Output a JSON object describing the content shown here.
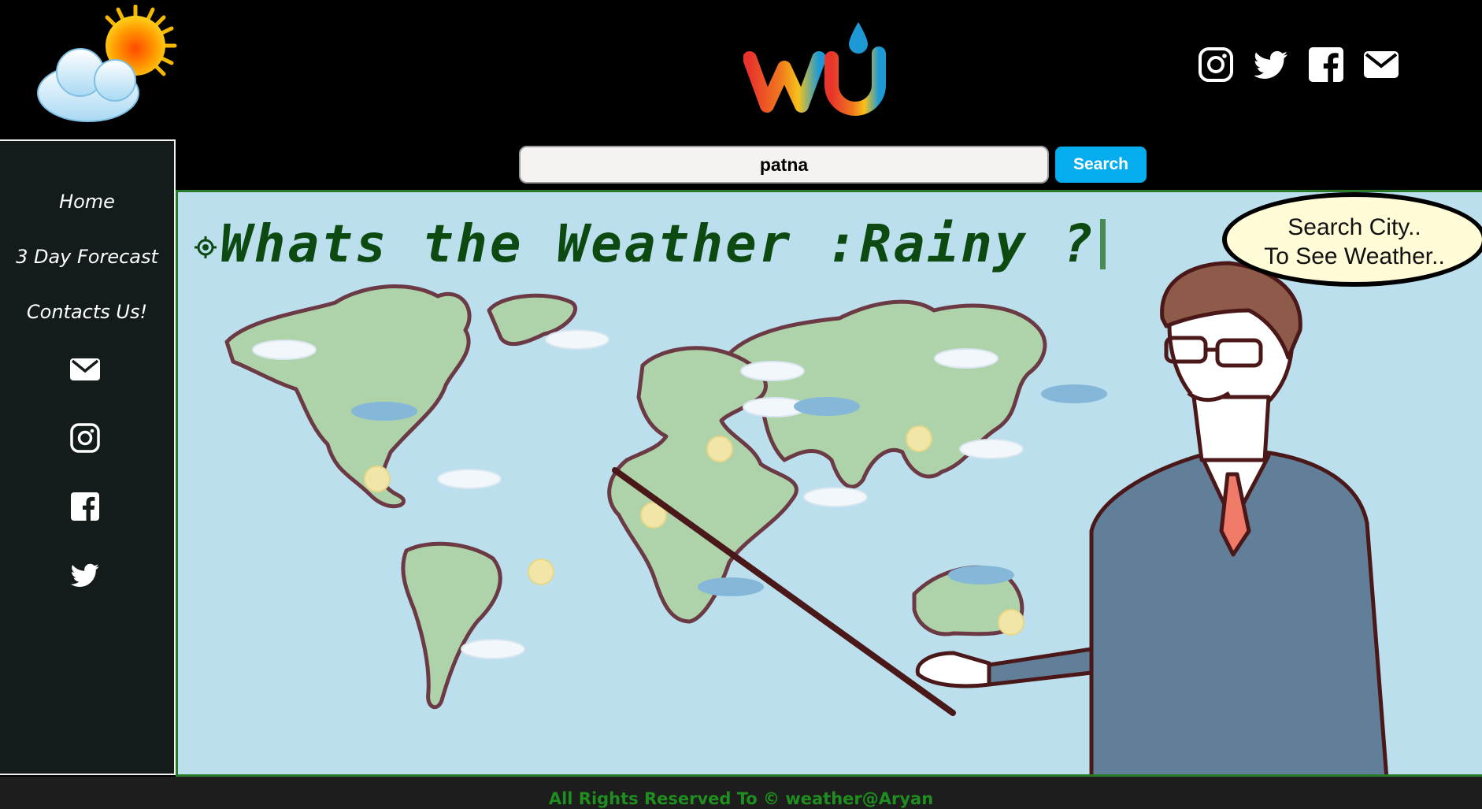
{
  "header": {
    "sun_logo_icon": "sun-behind-cloud-icon",
    "brand_logo_text": "wu",
    "social": [
      {
        "name": "instagram",
        "icon": "instagram-icon"
      },
      {
        "name": "twitter",
        "icon": "twitter-icon"
      },
      {
        "name": "facebook",
        "icon": "facebook-icon"
      },
      {
        "name": "email",
        "icon": "mail-icon"
      }
    ]
  },
  "sidebar": {
    "nav": [
      {
        "label": "Home"
      },
      {
        "label": "3 Day Forecast"
      },
      {
        "label": "Contacts Us!"
      }
    ],
    "icons": [
      "mail-icon",
      "instagram-icon",
      "facebook-icon",
      "twitter-icon"
    ]
  },
  "search": {
    "value": "patna",
    "button_label": "Search"
  },
  "main": {
    "headline": "Whats the Weather :Rainy ?",
    "locate_icon": "location-target-icon",
    "bubble_line1": "Search City..",
    "bubble_line2": "To See Weather.."
  },
  "footer": {
    "text": "All Rights Reserved To © weather@Aryan"
  },
  "colors": {
    "background": "#000000",
    "sidebar": "#141c1b",
    "accent_button": "#05adee",
    "headline": "#0c4a12",
    "footer_text": "#1f8e1f",
    "map_sky": "#bcdfee"
  }
}
